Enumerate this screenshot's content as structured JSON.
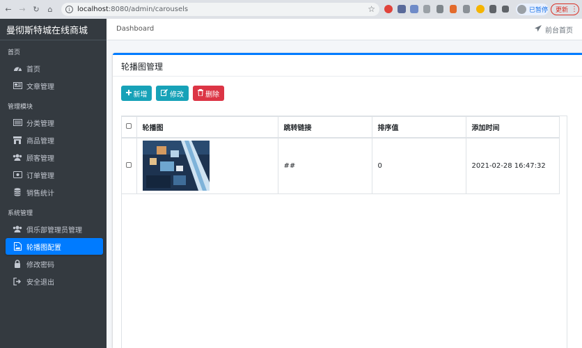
{
  "browser": {
    "url_host": "localhost",
    "url_rest": ":8080/admin/carousels",
    "profile_label": "已暂停",
    "update_label": "更新",
    "colors": {
      "chrome": "#dee1e6",
      "omnibox": "#f1f3f4"
    }
  },
  "app": {
    "brand": "曼彻斯特城在线商城",
    "breadcrumb": "Dashboard",
    "front_link": "前台首页"
  },
  "sidebar": {
    "sections": [
      {
        "header": "首页",
        "items": [
          {
            "label": "首页",
            "icon": "tachometer-icon"
          },
          {
            "label": "文章管理",
            "icon": "newspaper-icon"
          }
        ]
      },
      {
        "header": "管理模块",
        "items": [
          {
            "label": "分类管理",
            "icon": "list-alt-icon"
          },
          {
            "label": "商品管理",
            "icon": "store-icon"
          },
          {
            "label": "顾客管理",
            "icon": "users-icon"
          },
          {
            "label": "订单管理",
            "icon": "receipt-icon"
          },
          {
            "label": "销售统计",
            "icon": "database-icon"
          }
        ]
      },
      {
        "header": "系统管理",
        "items": [
          {
            "label": "俱乐部管理员管理",
            "icon": "users-icon"
          },
          {
            "label": "轮播图配置",
            "icon": "image-icon",
            "active": true
          },
          {
            "label": "修改密码",
            "icon": "lock-icon"
          },
          {
            "label": "安全退出",
            "icon": "sign-out-icon"
          }
        ]
      }
    ]
  },
  "card": {
    "title": "轮播图管理",
    "buttons": {
      "add": "新增",
      "edit": "修改",
      "delete": "删除"
    }
  },
  "table": {
    "headers": [
      "轮播图",
      "跳转链接",
      "排序值",
      "添加时间"
    ],
    "rows": [
      {
        "image": "carousel-thumbnail",
        "link": "##",
        "sort": "0",
        "created": "2021-02-28 16:47:32"
      }
    ]
  },
  "colors": {
    "primary": "#007bff",
    "info": "#17a2b8",
    "danger": "#dc3545",
    "sidebar": "#343a40"
  }
}
